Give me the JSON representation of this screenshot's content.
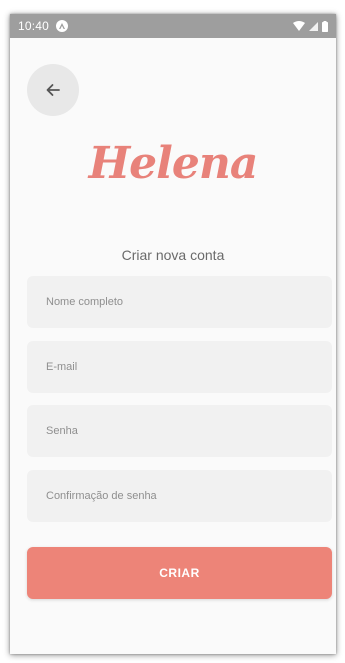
{
  "status_bar": {
    "time": "10:40",
    "badge_icon": "android-notification-icon",
    "wifi_icon": "wifi-icon",
    "signal_icon": "signal-icon",
    "battery_icon": "battery-icon",
    "background": "#9e9e9e"
  },
  "header": {
    "back_icon": "arrow-left-icon"
  },
  "brand": {
    "logo_text": "Helena",
    "color": "#e8827a"
  },
  "form": {
    "title": "Criar nova conta",
    "fields": [
      {
        "name": "full-name",
        "placeholder": "Nome completo",
        "value": ""
      },
      {
        "name": "email",
        "placeholder": "E-mail",
        "value": ""
      },
      {
        "name": "password",
        "placeholder": "Senha",
        "value": ""
      },
      {
        "name": "password-confirm",
        "placeholder": "Confirmação de senha",
        "value": ""
      }
    ],
    "submit_label": "CRIAR",
    "submit_color": "#ed8478"
  }
}
